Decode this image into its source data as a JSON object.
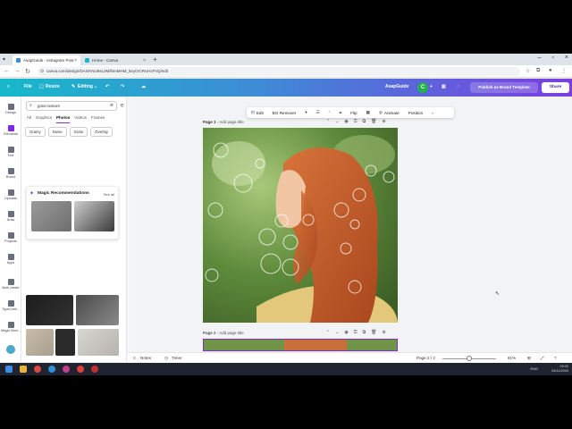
{
  "browser": {
    "tabs": [
      {
        "label": "AsapGuide - Instagram Post",
        "active": true
      },
      {
        "label": "Home - Canva",
        "active": false
      }
    ],
    "url": "canva.com/design/DAGKNU5sL2M/l0mMHM_keyCtCRUHzFnQ/edit"
  },
  "topbar": {
    "file": "File",
    "resize": "Resize",
    "editing": "Editing",
    "team_name": "AsapGuide",
    "avatar_initial": "C",
    "brand_template": "Publish as Brand Template",
    "share": "Share",
    "brand_gradient": [
      "#17b9c9",
      "#3e8bd6",
      "#7b3fe0"
    ]
  },
  "rail": [
    {
      "label": "Design"
    },
    {
      "label": "Elements",
      "active": true
    },
    {
      "label": "Text"
    },
    {
      "label": "Brand"
    },
    {
      "label": "Uploads"
    },
    {
      "label": "Draw"
    },
    {
      "label": "Projects"
    },
    {
      "label": "Apps"
    },
    {
      "label": "Bulk create"
    },
    {
      "label": "TypeCraft..."
    },
    {
      "label": "Magic Med..."
    }
  ],
  "panel": {
    "search_value": "grain texture",
    "tabs": [
      "All",
      "Graphics",
      "Photos",
      "Videos",
      "Frames"
    ],
    "active_tab": "Photos",
    "chips": [
      "Grainy",
      "Noise",
      "Grain",
      "Overlay"
    ],
    "magic_title": "Magic Recommendations",
    "see_all": "See all"
  },
  "contextbar": {
    "edit": "Edit",
    "bg_remover": "BG Remover",
    "flip": "Flip",
    "animate": "Animate",
    "position": "Position"
  },
  "pages": [
    {
      "label": "Page 1",
      "title_placeholder": "Add page title"
    },
    {
      "label": "Page 2",
      "title_placeholder": "Add page title"
    }
  ],
  "bottom": {
    "notes": "Notes",
    "timer": "Timer",
    "page_indicator": "Page 2 / 2",
    "zoom": "61%"
  },
  "taskbar": {
    "lang": "ENG",
    "time": "09:42",
    "date": "04/11/2024"
  }
}
